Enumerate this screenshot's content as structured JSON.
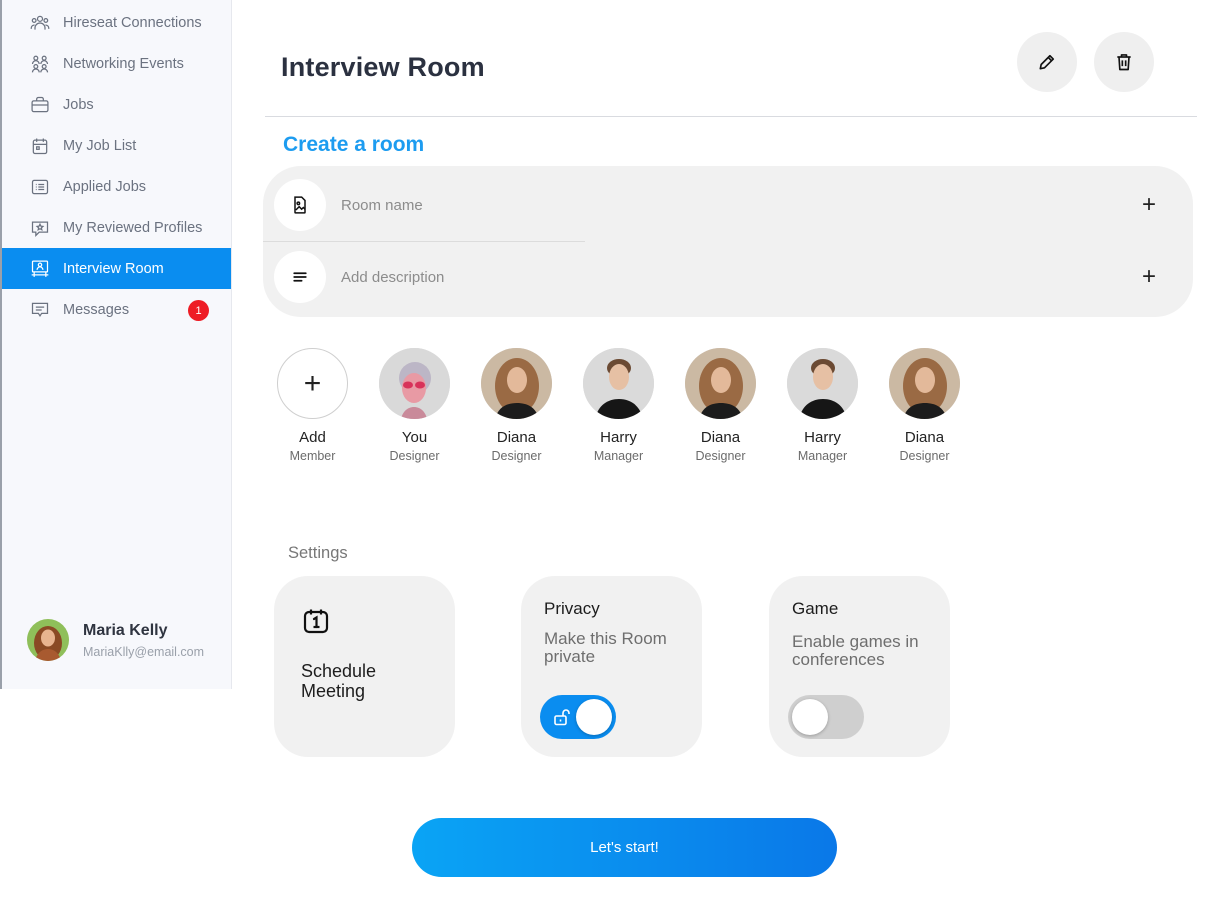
{
  "sidebar": {
    "items": [
      {
        "label": "Hireseat Connections",
        "icon": "connections-icon"
      },
      {
        "label": "Networking Events",
        "icon": "people-group-icon"
      },
      {
        "label": "Jobs",
        "icon": "briefcase-icon"
      },
      {
        "label": "My Job List",
        "icon": "calendar-icon"
      },
      {
        "label": "Applied Jobs",
        "icon": "list-icon"
      },
      {
        "label": "My Reviewed Profiles",
        "icon": "star-message-icon"
      },
      {
        "label": "Interview Room",
        "icon": "presentation-icon",
        "active": true
      },
      {
        "label": "Messages",
        "icon": "chat-icon",
        "badge": "1"
      }
    ],
    "profile": {
      "name": "Maria Kelly",
      "email": "MariaKlly@email.com"
    }
  },
  "header": {
    "title": "Interview Room"
  },
  "create": {
    "title": "Create a room",
    "room_name_placeholder": "Room name",
    "description_placeholder": "Add description"
  },
  "members": [
    {
      "name": "Add",
      "role": "Member",
      "kind": "add"
    },
    {
      "name": "You",
      "role": "Designer",
      "kind": "you"
    },
    {
      "name": "Diana",
      "role": "Designer",
      "kind": "diana"
    },
    {
      "name": "Harry",
      "role": "Manager",
      "kind": "harry"
    },
    {
      "name": "Diana",
      "role": "Designer",
      "kind": "diana"
    },
    {
      "name": "Harry",
      "role": "Manager",
      "kind": "harry"
    },
    {
      "name": "Diana",
      "role": "Designer",
      "kind": "diana"
    }
  ],
  "settings": {
    "label": "Settings",
    "schedule": {
      "title": "Schedule Meeting"
    },
    "privacy": {
      "title": "Privacy",
      "desc": "Make this Room private",
      "enabled": true
    },
    "game": {
      "title": "Game",
      "desc": "Enable games in conferences",
      "enabled": false
    }
  },
  "start_label": "Let's start!",
  "colors": {
    "accent": "#0a8df0",
    "badge": "#ee1c25",
    "title_blue": "#1d9cf0"
  }
}
